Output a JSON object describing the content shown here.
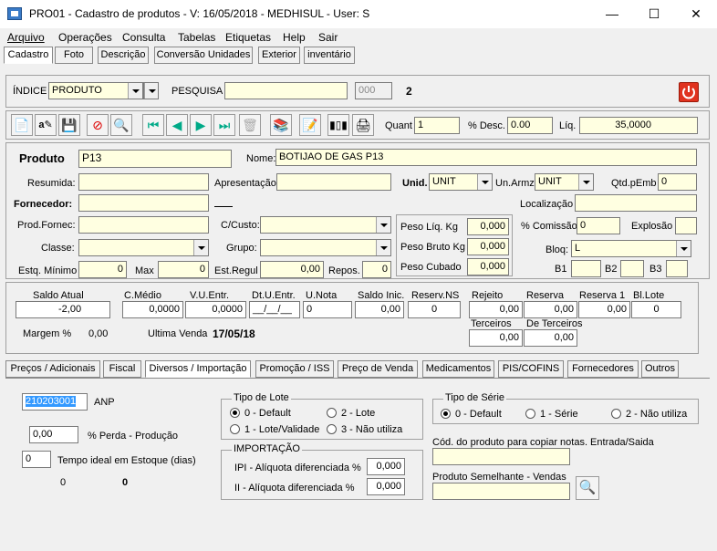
{
  "window": {
    "title": "PRO01 - Cadastro de produtos - V: 16/05/2018 - MEDHISUL - User: S",
    "minimize": "—",
    "maximize": "☐",
    "close": "✕"
  },
  "menu": [
    "Arquivo",
    "Operações",
    "Consulta",
    "Tabelas",
    "Etiquetas",
    "Help",
    "Sair"
  ],
  "top_tabs": [
    "Cadastro",
    "Foto",
    "Descrição",
    "Conversão Unidades",
    "Exterior",
    "inventário"
  ],
  "index_bar": {
    "indice_label": "ÍNDICE",
    "indice_value": "PRODUTO",
    "pesquisa_label": "PESQUISA",
    "pesquisa_value": "",
    "counter_value": "000",
    "count": "2"
  },
  "toolbar": {
    "quant_label": "Quant",
    "quant_value": "1",
    "desc_label": "% Desc.",
    "desc_value": "0.00",
    "liq_label": "Líq.",
    "liq_value": "35,0000"
  },
  "product": {
    "produto_label": "Produto",
    "produto_value": "P13",
    "nome_label": "Nome:",
    "nome_value": "BOTIJAO DE GAS P13",
    "resumida_label": "Resumida:",
    "apresentacao_label": "Apresentação",
    "unid_label": "Unid.",
    "unid_value": "UNIT",
    "unarmz_label": "Un.Armz",
    "unarmz_value": "UNIT",
    "qtdpemb_label": "Qtd.pEmb",
    "qtdpemb_value": "0",
    "fornecedor_label": "Fornecedor:",
    "localizacao_label": "Localização",
    "prodfornec_label": "Prod.Fornec:",
    "ccusto_label": "C/Custo:",
    "peso_liq_label": "Peso Líq. Kg",
    "peso_liq_value": "0,000",
    "comissao_label": "% Comissão",
    "comissao_value": "0",
    "explosao_label": "Explosão",
    "classe_label": "Classe:",
    "grupo_label": "Grupo:",
    "peso_bruto_label": "Peso Bruto Kg",
    "peso_bruto_value": "0,000",
    "bloq_label": "Bloq:",
    "bloq_value": "L",
    "estq_min_label": "Estq. Mínimo",
    "estq_min_value": "0",
    "max_label": "Max",
    "max_value": "0",
    "estregul_label": "Est.Regul",
    "estregul_value": "0,00",
    "repos_label": "Repos.",
    "repos_value": "0",
    "peso_cubado_label": "Peso Cubado",
    "peso_cubado_value": "0,000",
    "b1_label": "B1",
    "b2_label": "B2",
    "b3_label": "B3"
  },
  "stock": {
    "saldo_atual_label": "Saldo Atual",
    "saldo_atual_value": "-2,00",
    "cmedio_label": "C.Médio",
    "cmedio_value": "0,0000",
    "vuentr_label": "V.U.Entr.",
    "vuentr_value": "0,0000",
    "dtuentr_label": "Dt.U.Entr.",
    "dtuentr_value": "__/__/__",
    "unota_label": "U.Nota",
    "unota_value": "0",
    "saldo_inic_label": "Saldo Inic.",
    "saldo_inic_value": "0,00",
    "reserv_ns_label": "Reserv.NS",
    "reserv_ns_value": "0",
    "rejeito_label": "Rejeito",
    "rejeito_value": "0,00",
    "reserva_label": "Reserva",
    "reserva_value": "0,00",
    "reserva1_label": "Reserva 1",
    "reserva1_value": "0,00",
    "bilote_label": "Bl.Lote",
    "bilote_value": "0",
    "terceiros_label": "Terceiros",
    "terceiros_value": "0,00",
    "de_terceiros_label": "De Terceiros",
    "de_terceiros_value": "0,00",
    "margem_label": "Margem  %",
    "margem_value": "0,00",
    "ultima_venda_label": "Ultima Venda",
    "ultima_venda_value": "17/05/18"
  },
  "bottom_tabs": [
    "Preços / Adicionais",
    "Fiscal",
    "Diversos / Importação",
    "Promoção / ISS",
    "Preço de Venda",
    "Medicamentos",
    "PIS/COFINS",
    "Fornecedores",
    "Outros"
  ],
  "diversos": {
    "anp_value": "210203001",
    "anp_label": "ANP",
    "perda_value": "0,00",
    "perda_label": "% Perda - Produção",
    "tempo_value": "0",
    "tempo_label": "Tempo ideal em Estoque (dias)",
    "zero_a": "0",
    "zero_b": "0",
    "tipo_lote_legend": "Tipo de Lote",
    "lote_opts": [
      "0 - Default",
      "2 - Lote",
      "1 - Lote/Validade",
      "3 - Não utiliza"
    ],
    "importacao_legend": "IMPORTAÇÃO",
    "ipi_label": "IPI - Alíquota diferenciada %",
    "ipi_value": "0,000",
    "ii_label": "II - Alíquota diferenciada %",
    "ii_value": "0,000",
    "tipo_serie_legend": "Tipo de Série",
    "serie_opts": [
      "0 - Default",
      "1 - Série",
      "2 - Não utiliza"
    ],
    "cod_copiar_label": "Cód. do produto para copiar notas. Entrada/Saida",
    "semelhante_label": "Produto Semelhante - Vendas"
  },
  "colors": {
    "field_bg": "#ffffe1",
    "power_button": "#e0321e",
    "window_bg": "#f0f0f0"
  }
}
